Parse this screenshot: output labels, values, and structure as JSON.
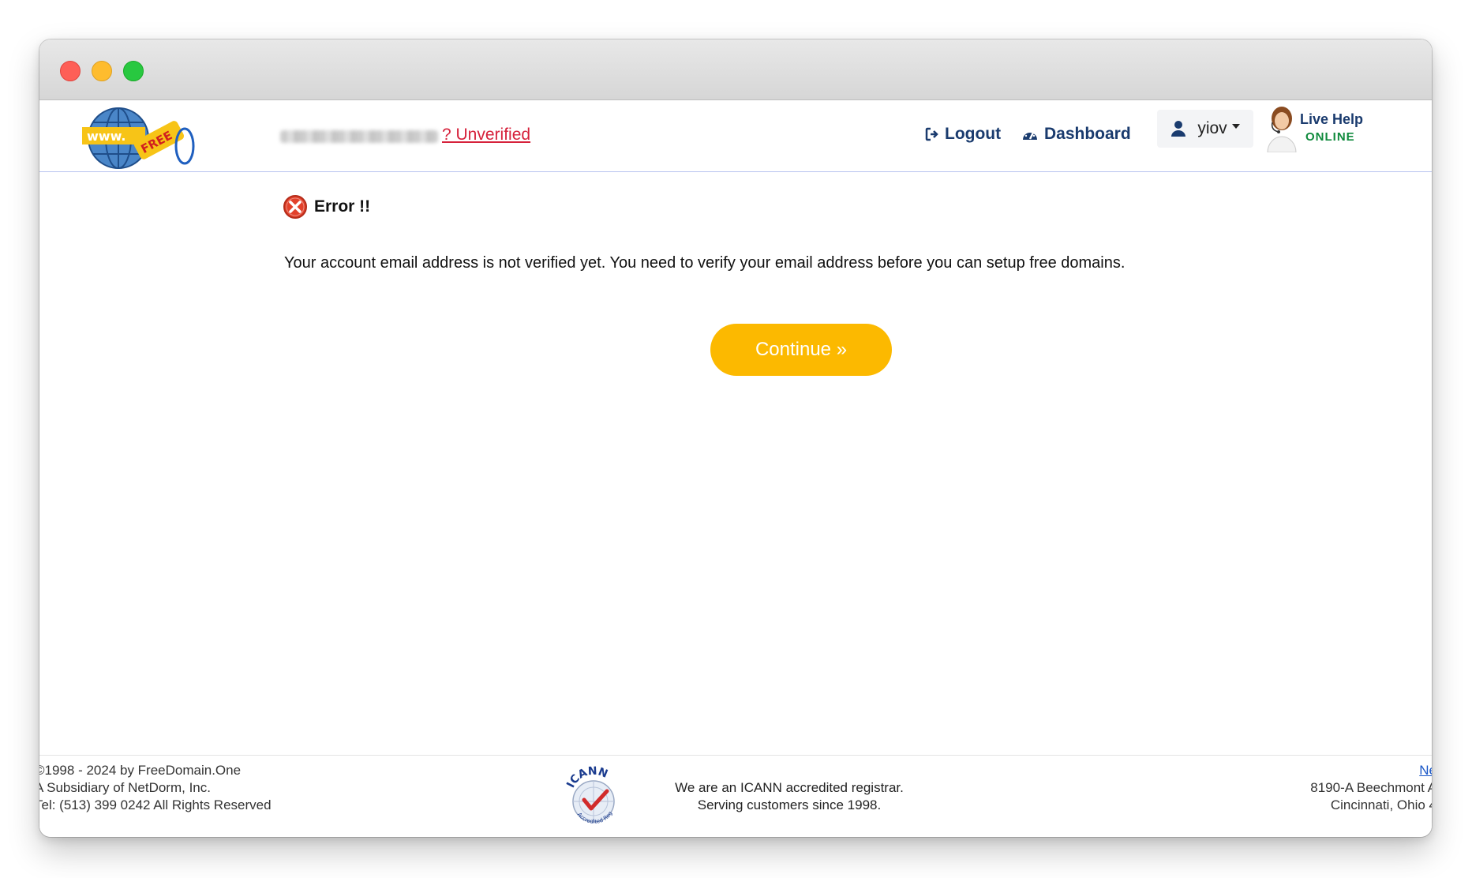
{
  "header": {
    "email_status": "? Unverified",
    "nav": {
      "logout": "Logout",
      "dashboard": "Dashboard"
    },
    "user": {
      "name": "yiov"
    },
    "live_help": {
      "title": "Live Help",
      "status": "ONLINE"
    }
  },
  "content": {
    "error_title": "Error !!",
    "error_message": "Your account email address is not verified yet. You need to verify your email address before you can setup free domains.",
    "continue_button": "Continue »"
  },
  "footer": {
    "left": [
      "©1998 - 2024 by FreeDomain.One",
      "A Subsidiary of NetDorm, Inc.",
      "Tel: (513) 399 0242 All Rights Reserved"
    ],
    "icann": {
      "line1": "We are an ICANN accredited registrar.",
      "line2": "Serving customers since 1998."
    },
    "right": {
      "link": "Ne",
      "address1": "8190-A Beechmont A",
      "address2": "Cincinnati, Ohio 4"
    }
  },
  "colors": {
    "accent": "#fcb900",
    "nav_text": "#1a3b6e",
    "unverified": "#d6213b",
    "online": "#0f8a3c"
  },
  "icons": [
    "logout-icon",
    "dashboard-icon",
    "user-icon",
    "error-icon",
    "support-agent-icon"
  ]
}
